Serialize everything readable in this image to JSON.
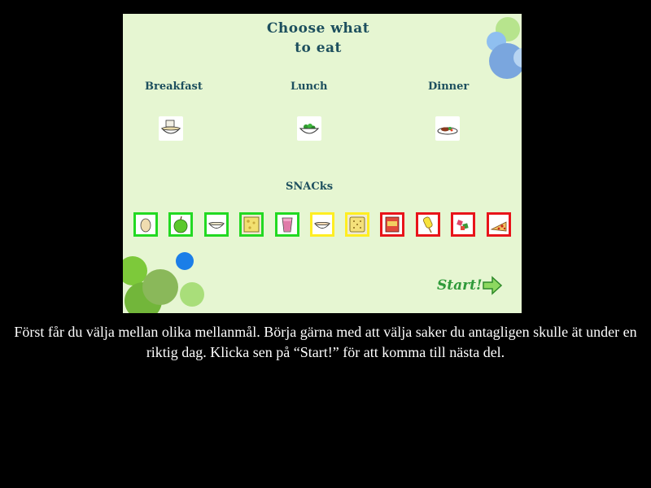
{
  "game": {
    "title_line1": "Choose what",
    "title_line2": "to eat",
    "meals": [
      {
        "label": "Breakfast",
        "item": "bowl-of-porridge-icon"
      },
      {
        "label": "Lunch",
        "item": "salad-bowl-icon"
      },
      {
        "label": "Dinner",
        "item": "dinner-plate-icon"
      }
    ],
    "snacks_label": "SNACks",
    "snacks": [
      {
        "item": "egg-icon",
        "color": "#22d922"
      },
      {
        "item": "apple-icon",
        "color": "#22d922"
      },
      {
        "item": "bowl-icon",
        "color": "#22d922"
      },
      {
        "item": "cheese-sandwich-icon",
        "color": "#22d922"
      },
      {
        "item": "glass-of-juice-icon",
        "color": "#22d922"
      },
      {
        "item": "bowl-icon",
        "color": "#ffee22"
      },
      {
        "item": "cracker-icon",
        "color": "#ffee22"
      },
      {
        "item": "chips-bag-icon",
        "color": "#e8141a"
      },
      {
        "item": "ice-cream-bar-icon",
        "color": "#e8141a"
      },
      {
        "item": "candy-icon",
        "color": "#e8141a"
      },
      {
        "item": "pizza-slice-icon",
        "color": "#e8141a"
      }
    ],
    "start_label": "Start!"
  },
  "instructions": {
    "text": "Först får du välja mellan olika mellanmål. Börja gärna med att välja saker du antagligen skulle ät under en riktig dag. Klicka sen på “Start!” för att komma till nästa del."
  },
  "colors": {
    "game_background": "#e6f6d2",
    "heading": "#1d4f5e",
    "start_text": "#2f9a3a",
    "healthy": "#22d922",
    "moderate": "#ffee22",
    "unhealthy": "#e8141a"
  }
}
